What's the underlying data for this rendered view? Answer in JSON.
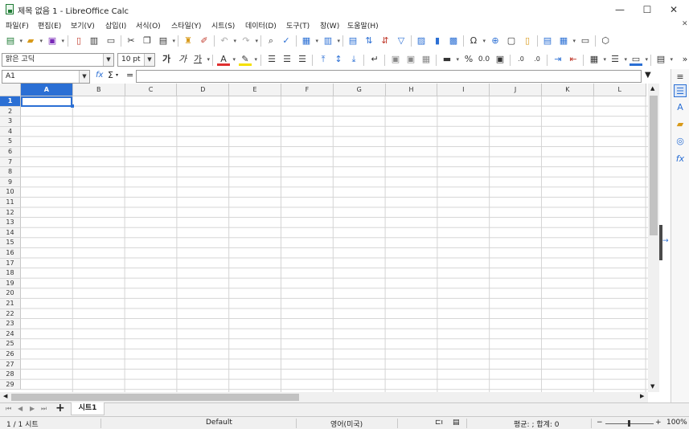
{
  "window": {
    "title": "제목 없음 1 - LibreOffice Calc",
    "minimize": "—",
    "maximize": "☐",
    "close": "✕"
  },
  "menu": [
    "파일(F)",
    "편집(E)",
    "보기(V)",
    "삽입(I)",
    "서식(O)",
    "스타일(Y)",
    "시트(S)",
    "데이터(D)",
    "도구(T)",
    "창(W)",
    "도움말(H)"
  ],
  "doc_close": "✕",
  "toolbar": {
    "font_name": "맑은 고딕",
    "font_size": "10 pt",
    "bold": "가",
    "italic": "가",
    "underline": "가",
    "percent": "%",
    "decimal": "0.0",
    "more": "»"
  },
  "formula_bar": {
    "name_box": "A1",
    "fx": "fx",
    "sum": "Σ",
    "equals": "=",
    "content": ""
  },
  "columns": [
    "A",
    "B",
    "C",
    "D",
    "E",
    "F",
    "G",
    "H",
    "I",
    "J",
    "K",
    "L"
  ],
  "rows": [
    "1",
    "2",
    "3",
    "4",
    "5",
    "6",
    "7",
    "8",
    "9",
    "10",
    "11",
    "12",
    "13",
    "14",
    "15",
    "16",
    "17",
    "18",
    "19",
    "20",
    "21",
    "22",
    "23",
    "24",
    "25",
    "26",
    "27",
    "28",
    "29"
  ],
  "selected_cell": "A1",
  "sheet_tabs": {
    "active": "시트1",
    "add": "+"
  },
  "status": {
    "sheet_count": "1 / 1 시트",
    "page_style": "Default",
    "language": "영어(미국)",
    "stats": "평균: ; 합계: 0",
    "zoom_minus": "−",
    "zoom_plus": "+",
    "zoom_percent": "100%"
  },
  "colors": {
    "accent": "#2b6fd4",
    "font_color": "#e03030",
    "highlight": "#f5e000",
    "app_green": "#1e7b34"
  }
}
